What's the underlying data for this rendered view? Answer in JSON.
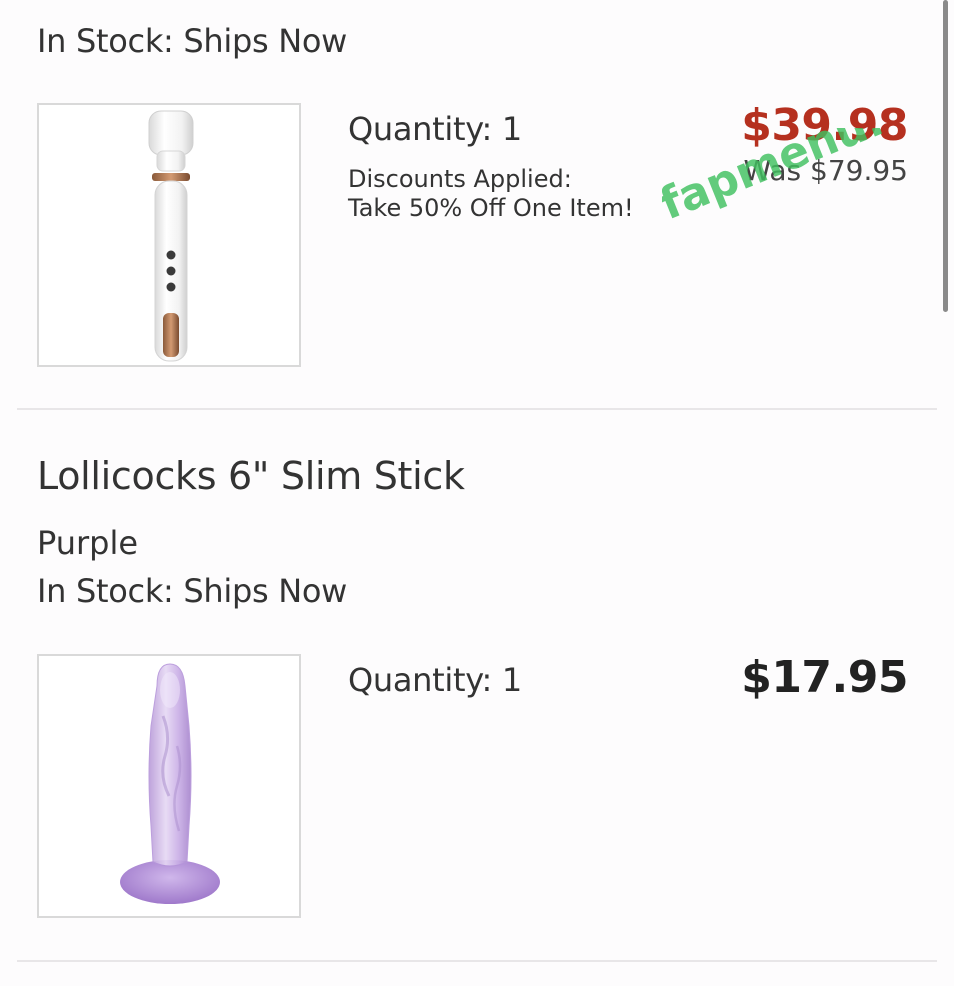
{
  "item1": {
    "stock_status": "In Stock: Ships Now",
    "quantity": "Quantity: 1",
    "discount_heading": "Discounts Applied:",
    "discount_detail": "Take 50% Off One Item!",
    "sale_price": "$39.98",
    "was_price": "Was $79.95",
    "image_icon": "wand-massager-image"
  },
  "item2": {
    "title": "Lollicocks 6\" Slim Stick",
    "variant": "Purple",
    "stock_status": "In Stock: Ships Now",
    "quantity": "Quantity: 1",
    "price": "$17.95",
    "image_icon": "purple-toy-image"
  },
  "watermark": {
    "text": "fapmenu.com"
  },
  "colors": {
    "sale_price": "#b5301f",
    "price": "#222222",
    "text": "#333333",
    "watermark": "#3fbf5f",
    "divider": "#e8e6e8"
  }
}
